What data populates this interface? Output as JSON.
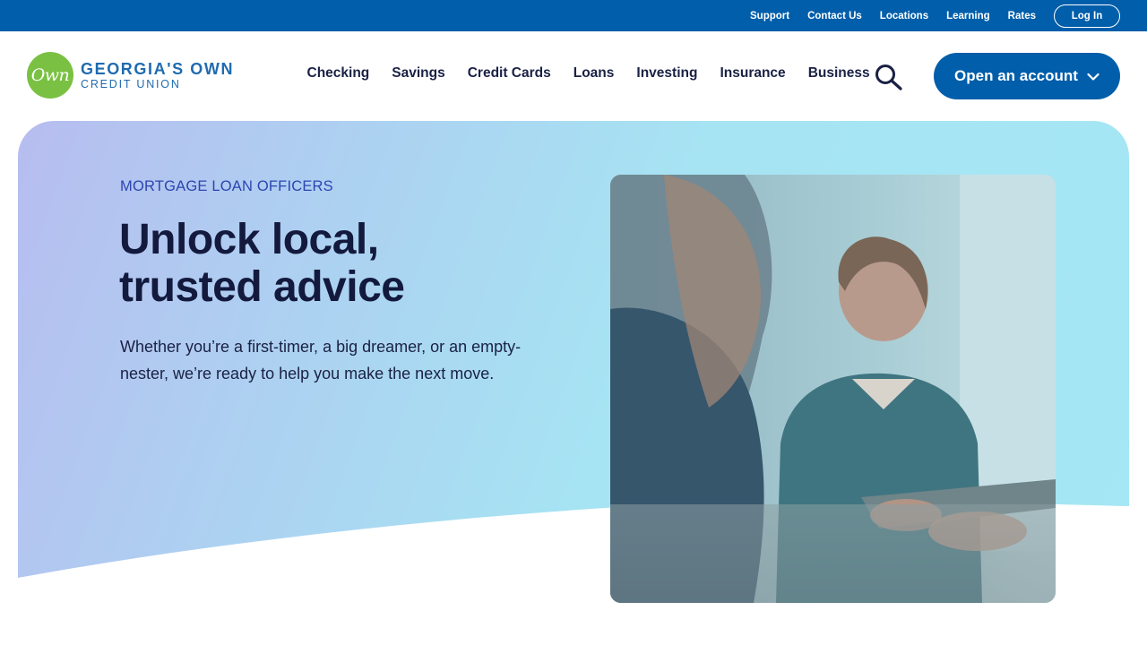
{
  "utility_nav": {
    "links": [
      "Support",
      "Contact Us",
      "Locations",
      "Learning",
      "Rates"
    ],
    "login_label": "Log In"
  },
  "logo": {
    "mark_text": "Own",
    "line1": "GEORGIA'S OWN",
    "line2": "CREDIT UNION"
  },
  "main_nav": {
    "items": [
      "Checking",
      "Savings",
      "Credit Cards",
      "Loans",
      "Investing",
      "Insurance",
      "Business"
    ],
    "cta_label": "Open an account"
  },
  "hero": {
    "eyebrow": "MORTGAGE LOAN OFFICERS",
    "title": "Unlock local, trusted advice",
    "body": "Whether you’re a first-timer, a big dreamer, or an empty-nester, we’re ready to help you make the next move."
  },
  "colors": {
    "brand_blue": "#005eaa",
    "logo_green": "#7ac143",
    "navy_text": "#131a3d"
  },
  "icons": {
    "search": "search-icon",
    "chevron": "chevron-down-icon"
  }
}
